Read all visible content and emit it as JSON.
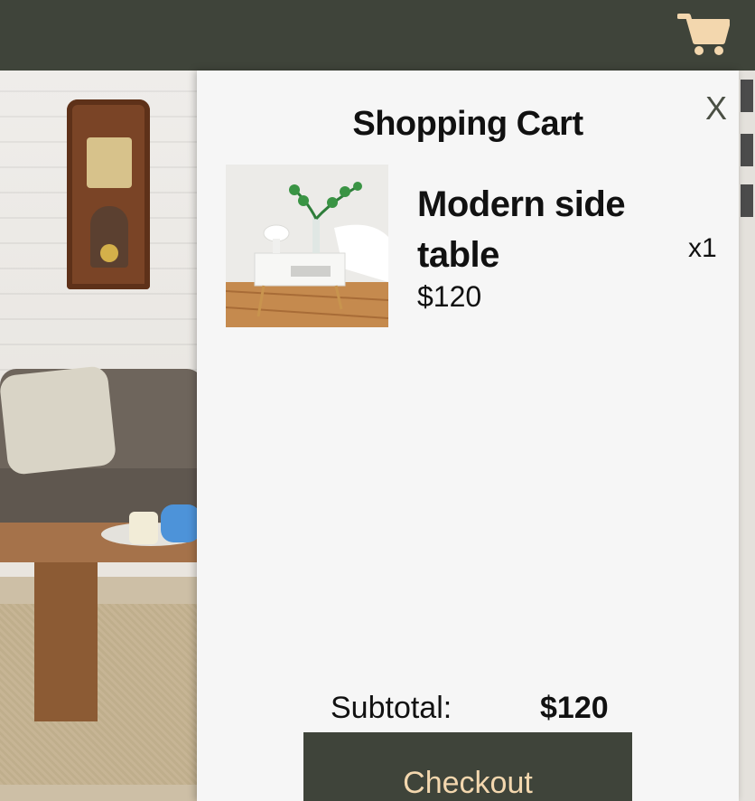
{
  "header": {
    "cart_icon": "shopping-cart-icon",
    "bar_color": "#3f443a",
    "icon_color": "#f3d7ae"
  },
  "cart": {
    "title": "Shopping Cart",
    "close_label": "X",
    "items": [
      {
        "name": "Modern side table",
        "price": "$120",
        "quantity": "x1",
        "image": "side-table-photo"
      }
    ],
    "subtotal_label": "Subtotal:",
    "subtotal_value": "$120",
    "checkout_label": "Checkout"
  },
  "colors": {
    "accent": "#3f443a",
    "checkout_text": "#f3d7ae",
    "drawer_background": "#f6f6f6"
  }
}
